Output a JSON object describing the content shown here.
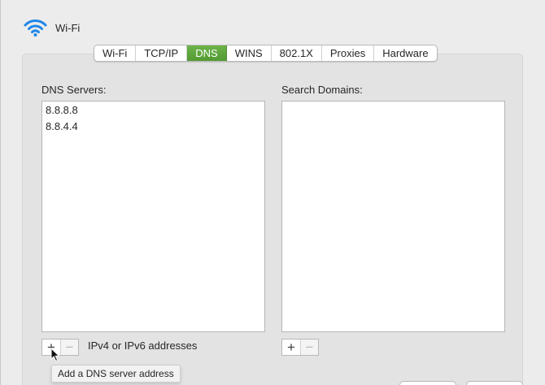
{
  "header": {
    "title": "Wi-Fi",
    "icon": "wifi-icon"
  },
  "tabs": [
    {
      "label": "Wi-Fi",
      "active": false
    },
    {
      "label": "TCP/IP",
      "active": false
    },
    {
      "label": "DNS",
      "active": true
    },
    {
      "label": "WINS",
      "active": false
    },
    {
      "label": "802.1X",
      "active": false
    },
    {
      "label": "Proxies",
      "active": false
    },
    {
      "label": "Hardware",
      "active": false
    }
  ],
  "dns": {
    "label": "DNS Servers:",
    "servers": [
      "8.8.8.8",
      "8.8.4.4"
    ],
    "hint": "IPv4 or IPv6 addresses"
  },
  "search": {
    "label": "Search Domains:",
    "domains": []
  },
  "buttons": {
    "add": "+",
    "remove": "−"
  },
  "tooltip": {
    "text": "Add a DNS server address"
  },
  "colors": {
    "accent": "#5aa53c",
    "wifi": "#1f86e8"
  }
}
